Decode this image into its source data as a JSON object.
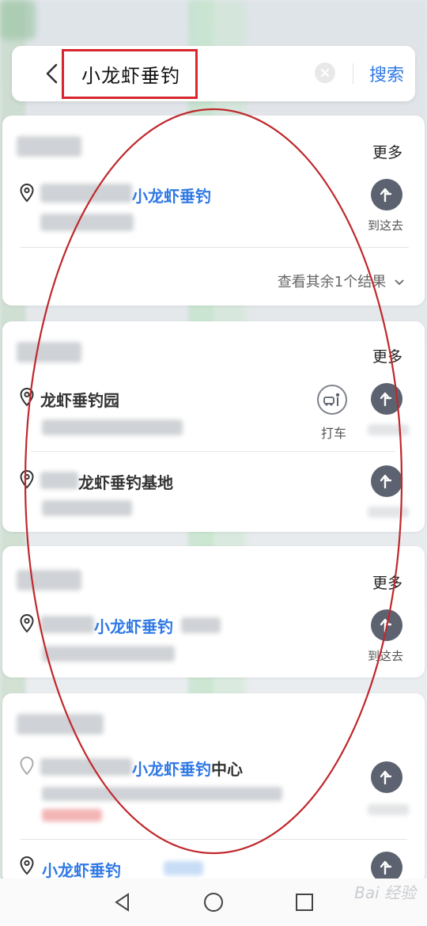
{
  "search": {
    "query": "小龙虾垂钓",
    "button_label": "搜索"
  },
  "groups": [
    {
      "more_label": "更多",
      "items": [
        {
          "name_highlight": "小龙虾垂钓",
          "nav_label": "到这去"
        }
      ],
      "other_results_label": "查看其余1个结果"
    },
    {
      "more_label": "更多",
      "items": [
        {
          "name_plain": "龙虾垂钓园",
          "taxi_label": "打车"
        },
        {
          "name_plain": "龙虾垂钓基地"
        }
      ]
    },
    {
      "more_label": "更多",
      "items": [
        {
          "name_highlight": "小龙虾垂钓",
          "nav_label": "到这去"
        }
      ]
    },
    {
      "items": [
        {
          "name_highlight": "小龙虾垂钓",
          "name_suffix": "中心"
        },
        {
          "name_highlight": "小龙虾垂钓"
        }
      ]
    }
  ],
  "colors": {
    "accent": "#2f78e5",
    "annotation_red": "#d8262e",
    "nav_button": "#5c6270"
  },
  "icons": {
    "back": "chevron-left-icon",
    "clear": "clear-icon",
    "pin": "location-pin-icon",
    "nav": "route-arrow-icon",
    "taxi": "taxi-icon",
    "more_chevron": "chevron-down-icon",
    "sys_back": "triangle-back-icon",
    "sys_home": "circle-home-icon",
    "sys_recent": "square-recent-icon"
  },
  "watermark": "Bai 经验"
}
